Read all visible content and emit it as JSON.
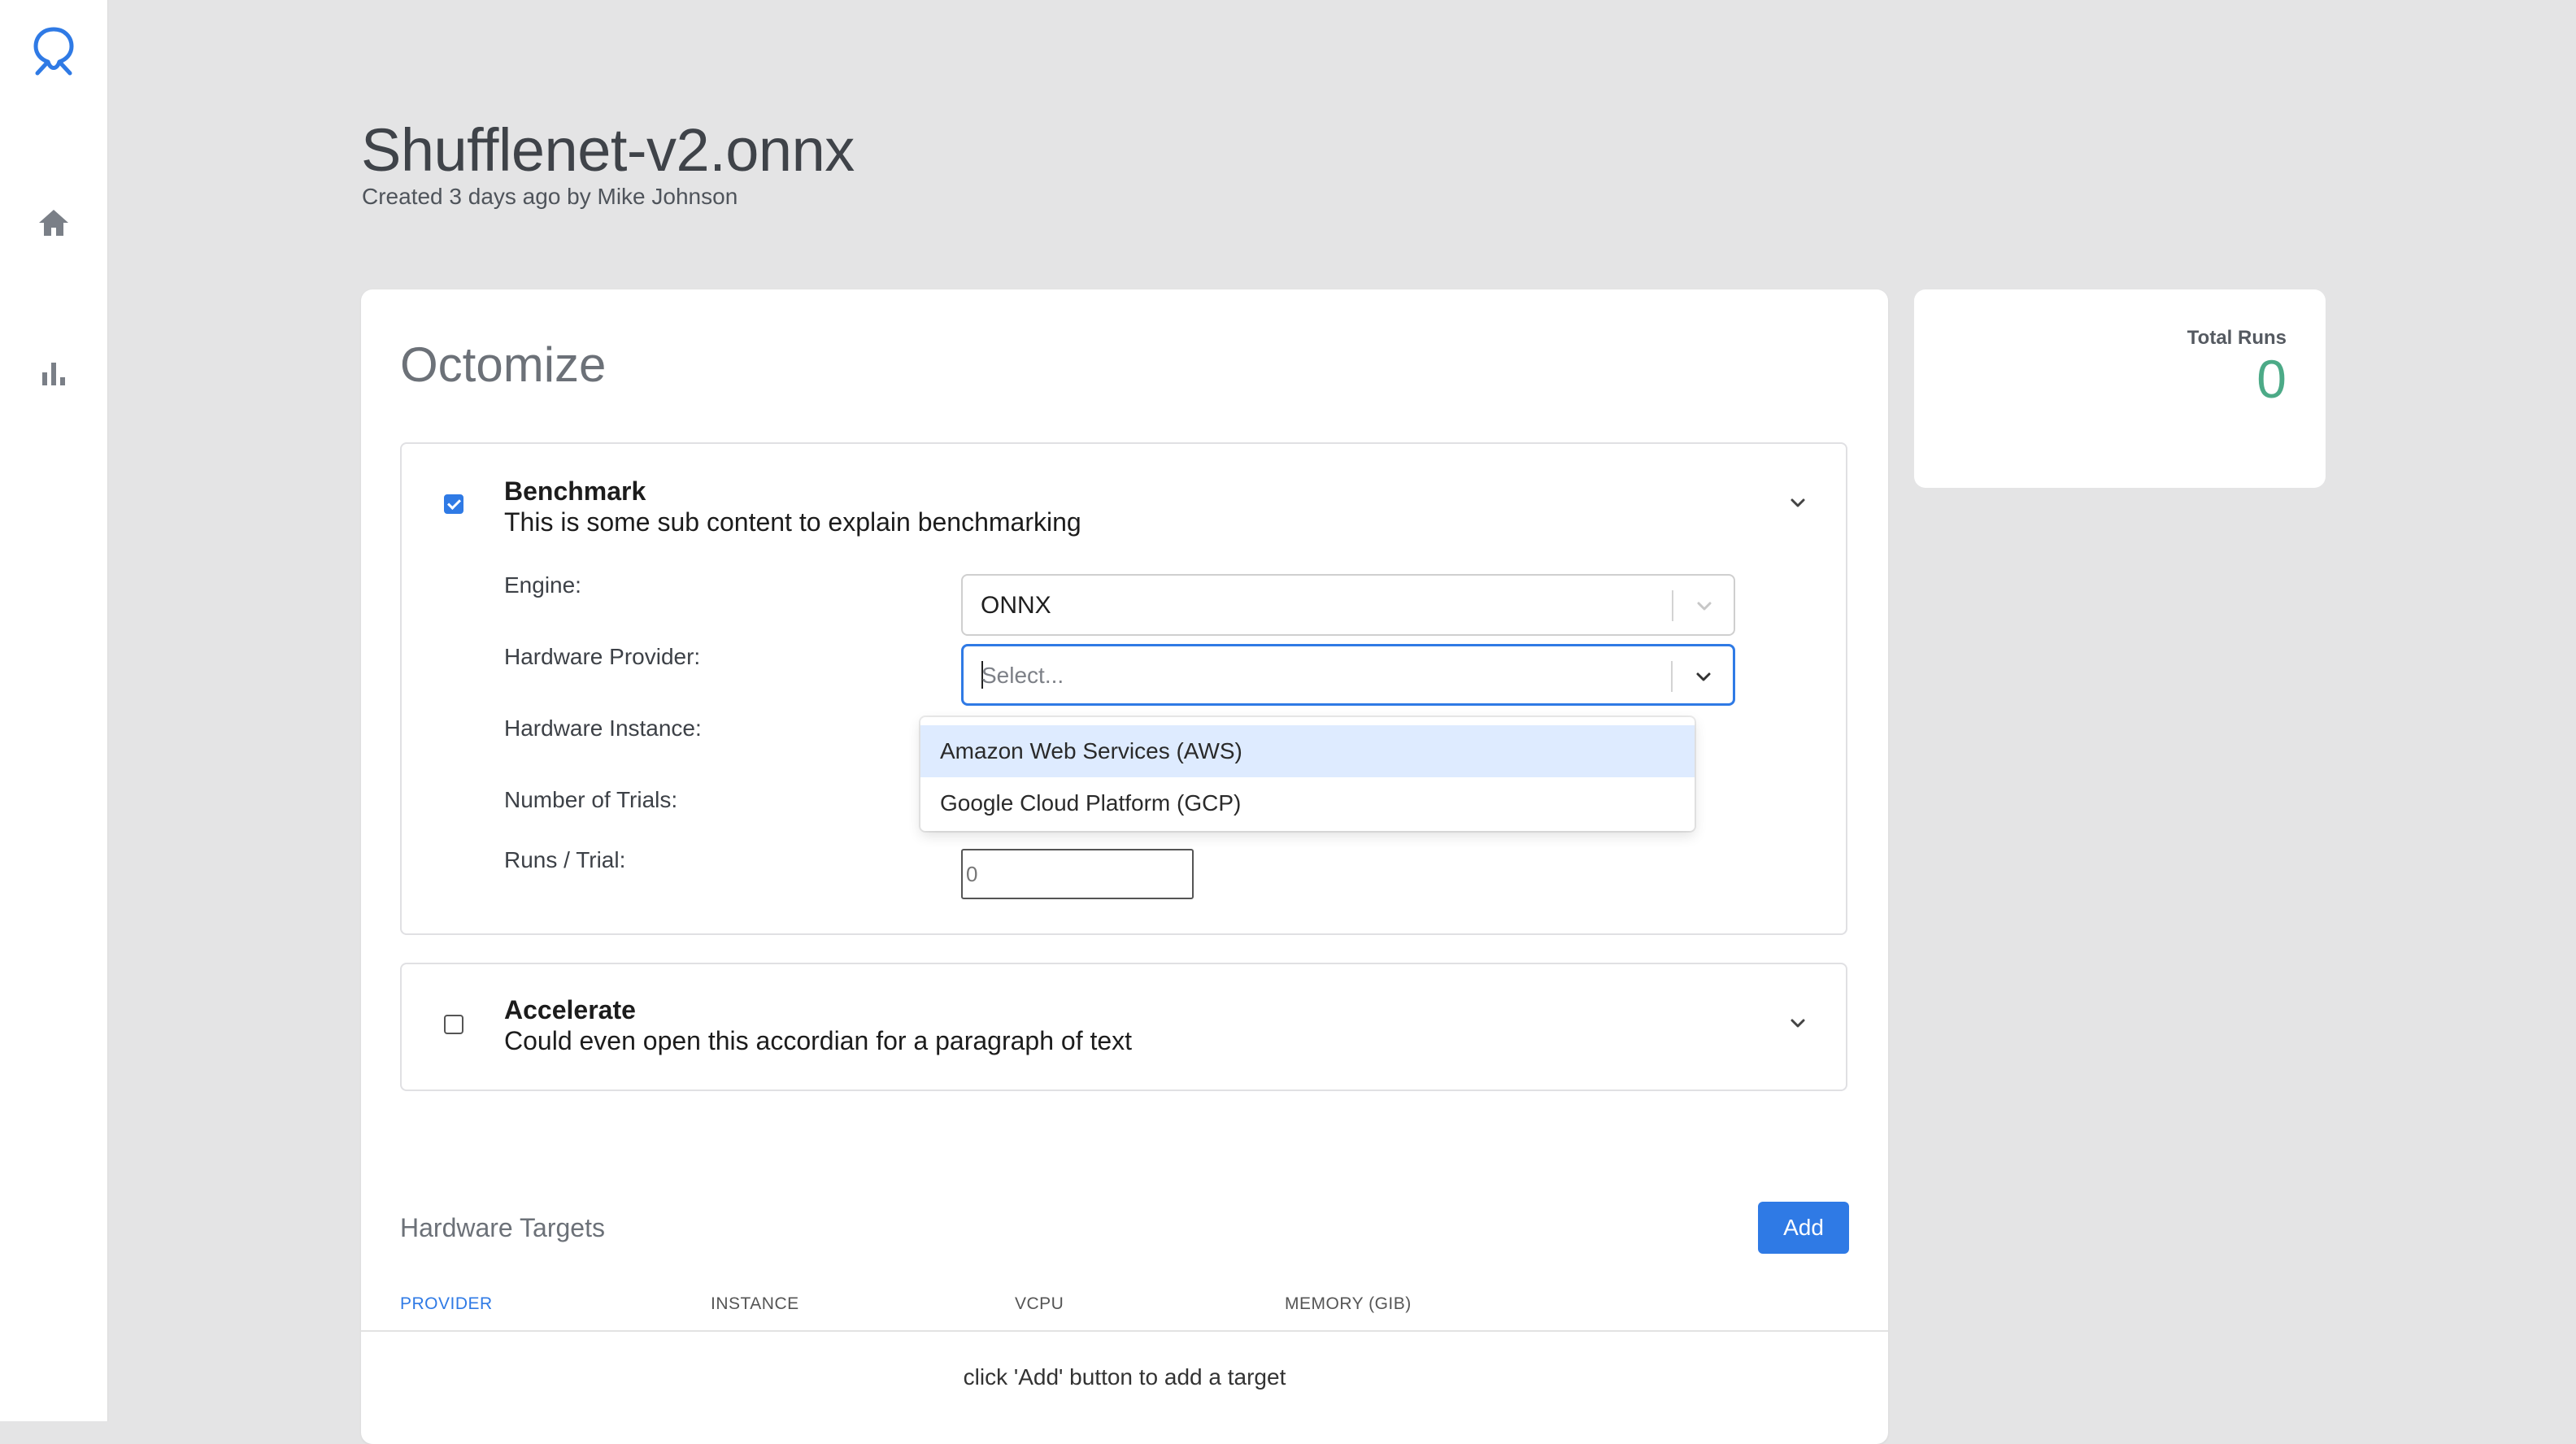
{
  "sidebar": {
    "icons": [
      "logo-icon",
      "home-icon",
      "bar-chart-icon"
    ]
  },
  "header": {
    "title": "Shufflenet-v2.onnx",
    "subtitle": "Created 3 days ago by Mike Johnson"
  },
  "main": {
    "title": "Octomize",
    "benchmark": {
      "title": "Benchmark",
      "description": "This is some sub content to explain benchmarking",
      "checked": true,
      "fields": {
        "engine_label": "Engine:",
        "engine_value": "ONNX",
        "provider_label": "Hardware Provider:",
        "provider_placeholder": "Select...",
        "instance_label": "Hardware Instance:",
        "trials_label": "Number of Trials:",
        "runs_label": "Runs / Trial:",
        "runs_value": "0"
      },
      "provider_options": [
        "Amazon Web Services (AWS)",
        "Google Cloud Platform (GCP)"
      ]
    },
    "accelerate": {
      "title": "Accelerate",
      "description": "Could even open this accordian for a paragraph of text",
      "checked": false
    },
    "hardware_targets": {
      "title": "Hardware Targets",
      "add_label": "Add",
      "columns": [
        "PROVIDER",
        "INSTANCE",
        "VCPU",
        "MEMORY (GIB)"
      ],
      "empty_message": "click 'Add' button to add a target"
    }
  },
  "stats": {
    "total_runs_label": "Total Runs",
    "total_runs_value": "0"
  },
  "colors": {
    "accent": "#2f7ae5",
    "success": "#4caa87",
    "background": "#e4e4e5"
  }
}
